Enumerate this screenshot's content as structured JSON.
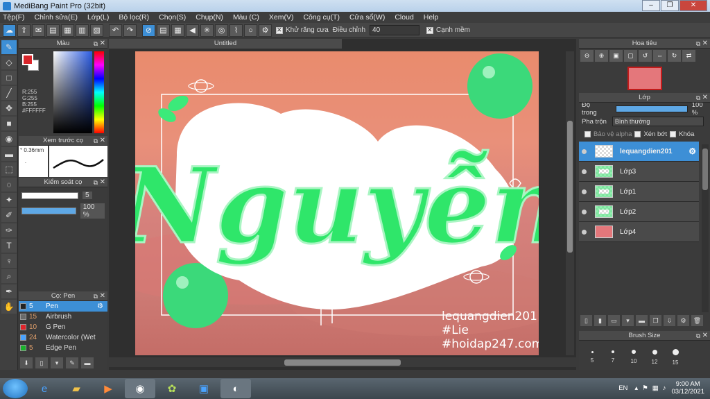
{
  "window": {
    "title": "MediBang Paint Pro (32bit)"
  },
  "menu": [
    "Tệp(F)",
    "Chỉnh sửa(E)",
    "Lớp(L)",
    "Bộ lọc(R)",
    "Chọn(S)",
    "Chụp(N)",
    "Màu (C)",
    "Xem(V)",
    "Công cụ(T)",
    "Cửa sổ(W)",
    "Cloud",
    "Help"
  ],
  "toolbar": {
    "antialias_label": "Khử răng cưa",
    "correction_label": "Điều chỉnh",
    "correction_value": "40",
    "sharp_edge_label": "Cạnh mềm"
  },
  "color_panel": {
    "title": "Màu",
    "r": "R:255",
    "g": "G:255",
    "b": "B:255",
    "hex": "#FFFFFF"
  },
  "brush_preview": {
    "title": "Xem trước cọ",
    "size": "0.36mm"
  },
  "brush_control": {
    "title": "Kiểm soát cọ",
    "size_value": "5",
    "opacity_value": "100 %"
  },
  "brush_list": {
    "title": "Cọ: Pen",
    "items": [
      {
        "size": "5",
        "name": "Pen",
        "color": "#222222"
      },
      {
        "size": "15",
        "name": "Airbrush",
        "color": "#6a6a6a"
      },
      {
        "size": "10",
        "name": "G Pen",
        "color": "#e0242a"
      },
      {
        "size": "24",
        "name": "Watercolor (Wet",
        "color": "#4aa3ff"
      },
      {
        "size": "5",
        "name": "Edge Pen",
        "color": "#19b22a"
      }
    ]
  },
  "document": {
    "tab": "Untitled",
    "main_text": "Nguyễn",
    "watermark": [
      "lequangdien201",
      "#Lie",
      "#hoidap247.com"
    ]
  },
  "navigator": {
    "title": "Hoa tiêu"
  },
  "layers": {
    "title": "Lớp",
    "opacity_label": "Độ trong",
    "opacity_value": "100 %",
    "blend_label": "Pha trộn",
    "blend_value": "Bình thường",
    "protect_alpha": "Bảo vệ alpha",
    "clipping": "Xén bớt",
    "lock": "Khóa",
    "items": [
      "lequangdien201",
      "Lớp3",
      "Lớp1",
      "Lớp2",
      "Lớp4"
    ]
  },
  "brush_size": {
    "title": "Brush Size",
    "sizes": [
      "5",
      "7",
      "10",
      "12",
      "15"
    ]
  },
  "taskbar": {
    "lang": "EN",
    "time": "9:00 AM",
    "date": "03/12/2021"
  }
}
